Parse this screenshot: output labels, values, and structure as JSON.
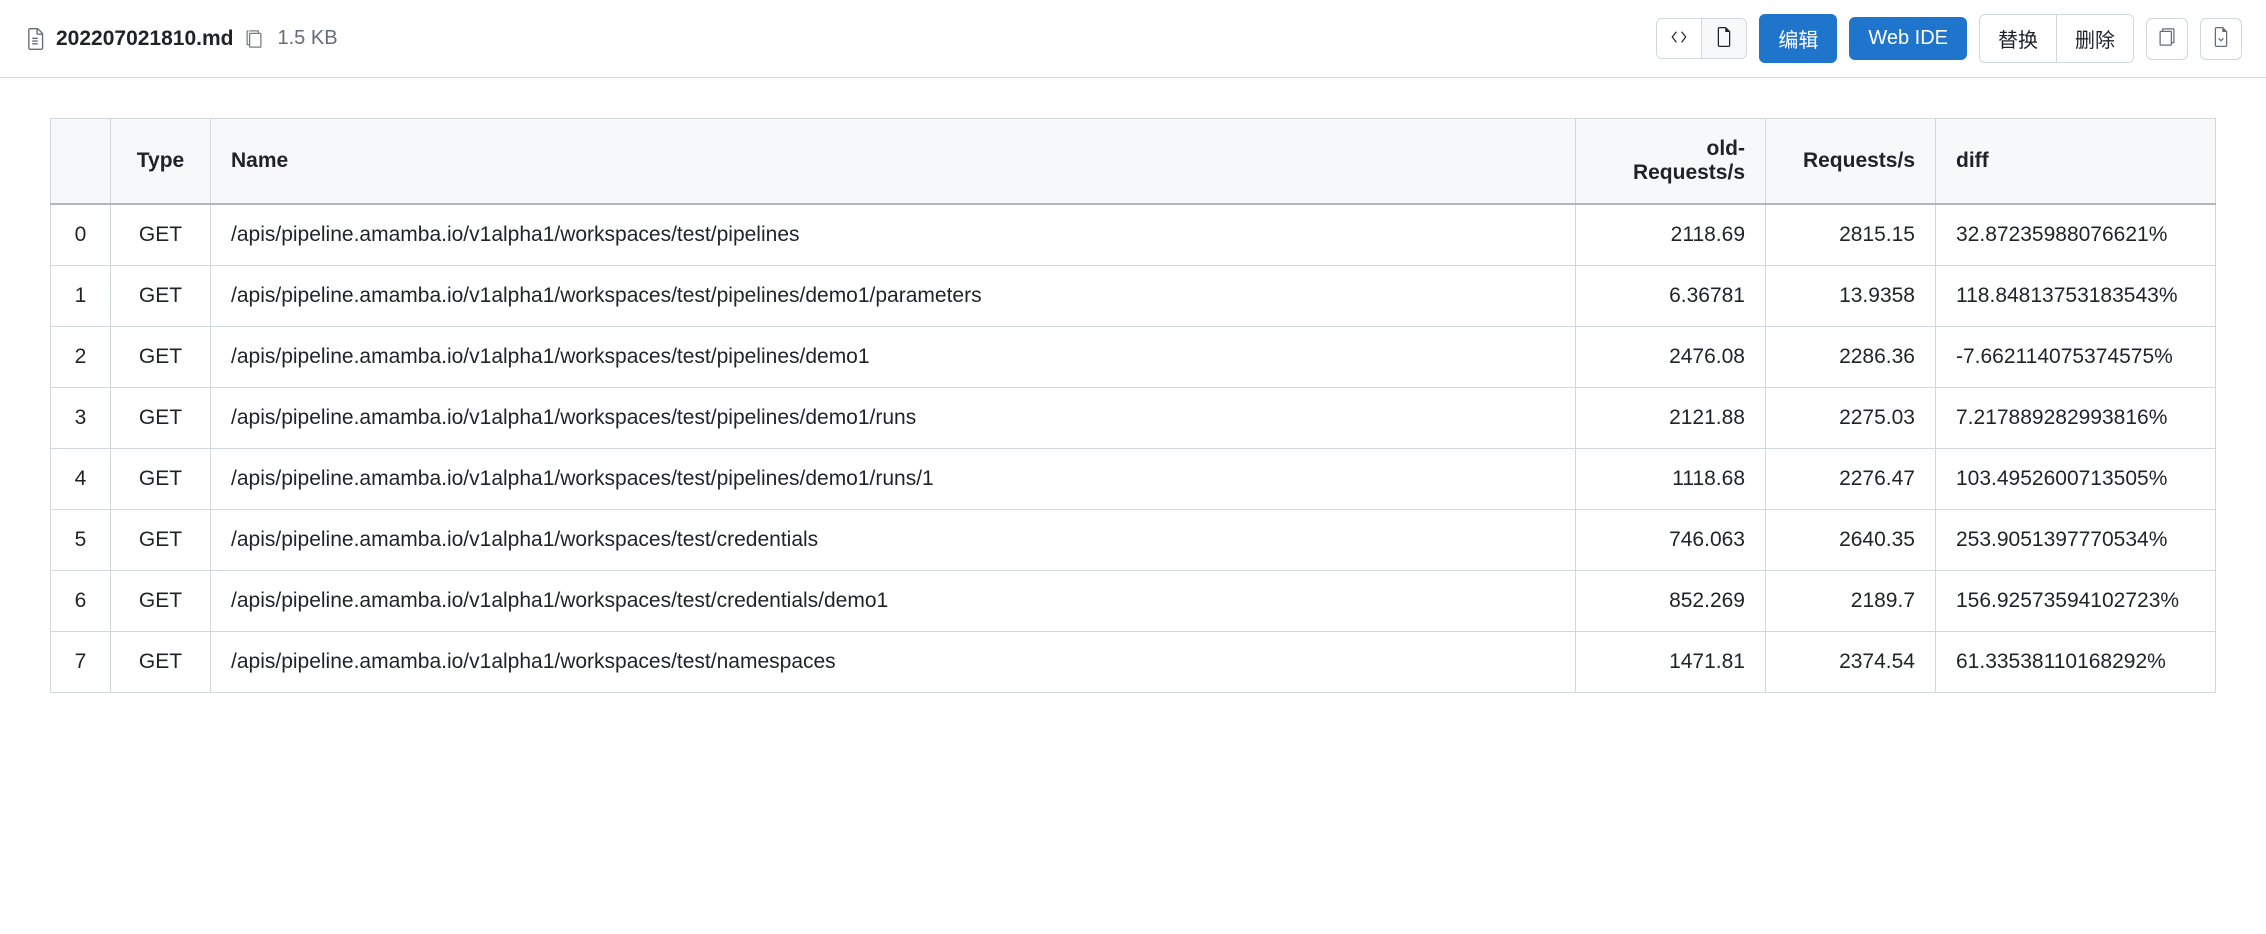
{
  "header": {
    "filename": "202207021810.md",
    "filesize": "1.5 KB",
    "edit_label": "编辑",
    "webide_label": "Web IDE",
    "replace_label": "替换",
    "delete_label": "删除"
  },
  "table": {
    "headers": {
      "idx": "",
      "type": "Type",
      "name": "Name",
      "old": "old-Requests/s",
      "req": "Requests/s",
      "diff": "diff"
    },
    "rows": [
      {
        "idx": "0",
        "type": "GET",
        "name": "/apis/pipeline.amamba.io/v1alpha1/workspaces/test/pipelines",
        "old": "2118.69",
        "req": "2815.15",
        "diff": "32.87235988076621%"
      },
      {
        "idx": "1",
        "type": "GET",
        "name": "/apis/pipeline.amamba.io/v1alpha1/workspaces/test/pipelines/demo1/parameters",
        "old": "6.36781",
        "req": "13.9358",
        "diff": "118.84813753183543%"
      },
      {
        "idx": "2",
        "type": "GET",
        "name": "/apis/pipeline.amamba.io/v1alpha1/workspaces/test/pipelines/demo1",
        "old": "2476.08",
        "req": "2286.36",
        "diff": "-7.662114075374575%"
      },
      {
        "idx": "3",
        "type": "GET",
        "name": "/apis/pipeline.amamba.io/v1alpha1/workspaces/test/pipelines/demo1/runs",
        "old": "2121.88",
        "req": "2275.03",
        "diff": "7.217889282993816%"
      },
      {
        "idx": "4",
        "type": "GET",
        "name": "/apis/pipeline.amamba.io/v1alpha1/workspaces/test/pipelines/demo1/runs/1",
        "old": "1118.68",
        "req": "2276.47",
        "diff": "103.4952600713505%"
      },
      {
        "idx": "5",
        "type": "GET",
        "name": "/apis/pipeline.amamba.io/v1alpha1/workspaces/test/credentials",
        "old": "746.063",
        "req": "2640.35",
        "diff": "253.9051397770534%"
      },
      {
        "idx": "6",
        "type": "GET",
        "name": "/apis/pipeline.amamba.io/v1alpha1/workspaces/test/credentials/demo1",
        "old": "852.269",
        "req": "2189.7",
        "diff": "156.92573594102723%"
      },
      {
        "idx": "7",
        "type": "GET",
        "name": "/apis/pipeline.amamba.io/v1alpha1/workspaces/test/namespaces",
        "old": "1471.81",
        "req": "2374.54",
        "diff": "61.33538110168292%"
      }
    ]
  }
}
